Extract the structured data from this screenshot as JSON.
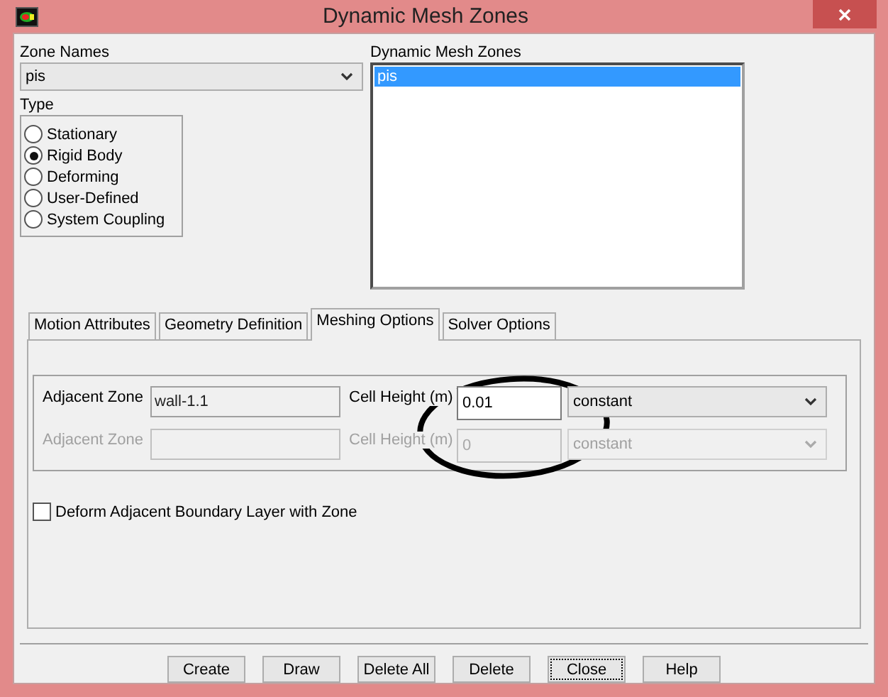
{
  "window": {
    "title": "Dynamic Mesh Zones"
  },
  "zone_names": {
    "label": "Zone Names",
    "value": "pis"
  },
  "type": {
    "label": "Type",
    "options": [
      {
        "label": "Stationary",
        "selected": false
      },
      {
        "label": "Rigid Body",
        "selected": true
      },
      {
        "label": "Deforming",
        "selected": false
      },
      {
        "label": "User-Defined",
        "selected": false
      },
      {
        "label": "System Coupling",
        "selected": false
      }
    ]
  },
  "dynamic_mesh_zones": {
    "label": "Dynamic Mesh Zones",
    "items": [
      {
        "label": "pis",
        "selected": true
      }
    ]
  },
  "tabs": [
    {
      "label": "Motion Attributes",
      "selected": false
    },
    {
      "label": "Geometry Definition",
      "selected": false
    },
    {
      "label": "Meshing Options",
      "selected": true
    },
    {
      "label": "Solver Options",
      "selected": false
    }
  ],
  "meshing_rows": [
    {
      "zone_label": "Adjacent Zone",
      "zone_value": "wall-1.1",
      "height_label": "Cell Height (m)",
      "height_value": "0.01",
      "method": "constant",
      "disabled": false
    },
    {
      "zone_label": "Adjacent Zone",
      "height_label": "Cell Height (m)",
      "height_value": "0",
      "method": "constant",
      "disabled": true
    }
  ],
  "deform_checkbox": {
    "label": "Deform Adjacent Boundary Layer with Zone",
    "checked": false
  },
  "buttons": [
    {
      "label": "Create",
      "focused": false
    },
    {
      "label": "Draw",
      "focused": false
    },
    {
      "label": "Delete All",
      "focused": false
    },
    {
      "label": "Delete",
      "focused": false
    },
    {
      "label": "Close",
      "focused": true
    },
    {
      "label": "Help",
      "focused": false
    }
  ],
  "annotation": {
    "kind": "ellipse"
  }
}
